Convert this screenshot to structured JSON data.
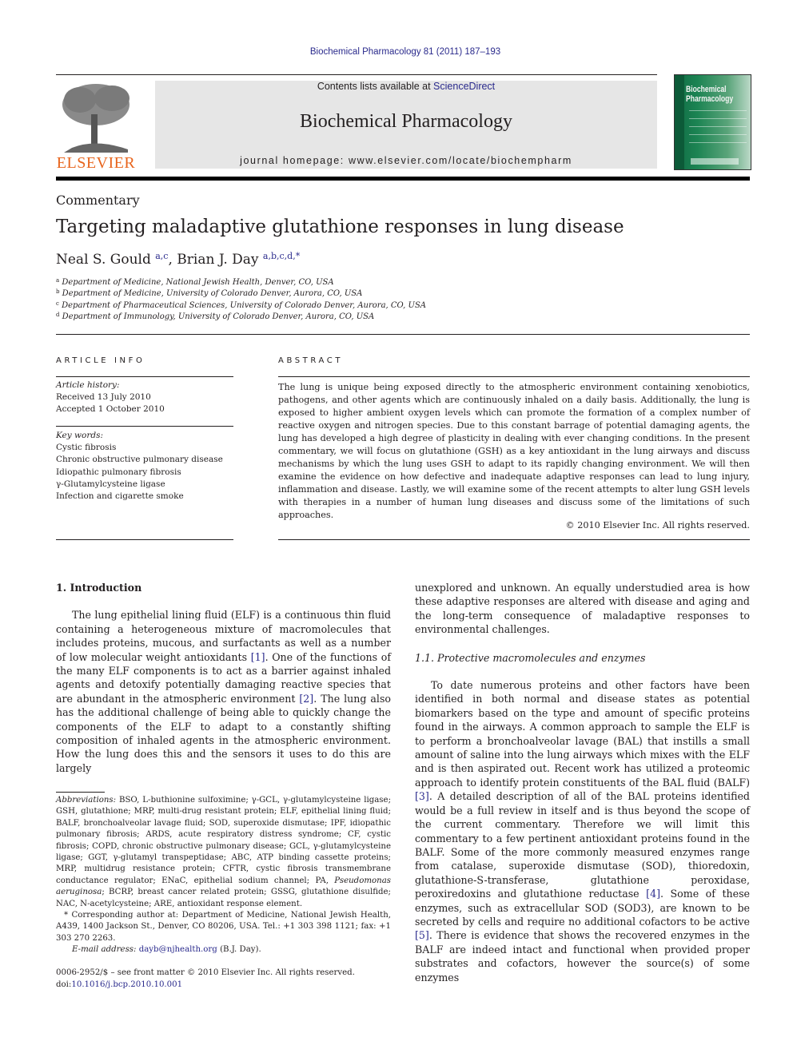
{
  "running_head": "Biochemical Pharmacology 81 (2011) 187–193",
  "masthead": {
    "publisher_logo_text": "ELSEVIER",
    "contents_prefix": "Contents lists available at ",
    "contents_link": "ScienceDirect",
    "journal_name": "Biochemical Pharmacology",
    "homepage": "journal homepage: www.elsevier.com/locate/biochempharm",
    "cover_title_line1": "Biochemical",
    "cover_title_line2": "Pharmacology"
  },
  "article": {
    "type": "Commentary",
    "title": "Targeting maladaptive glutathione responses in lung disease",
    "authors": [
      {
        "name": "Neal S. Gould",
        "affils": "a,c",
        "sep": ", "
      },
      {
        "name": "Brian J. Day",
        "affils": "a,b,c,d,*",
        "sep": ""
      }
    ],
    "affiliations": [
      {
        "mark": "a",
        "text": "Department of Medicine, National Jewish Health, Denver, CO, USA"
      },
      {
        "mark": "b",
        "text": "Department of Medicine, University of Colorado Denver, Aurora, CO, USA"
      },
      {
        "mark": "c",
        "text": "Department of Pharmaceutical Sciences, University of Colorado Denver, Aurora, CO, USA"
      },
      {
        "mark": "d",
        "text": "Department of Immunology, University of Colorado Denver, Aurora, CO, USA"
      }
    ]
  },
  "article_info": {
    "heading": "ARTICLE INFO",
    "history_label": "Article history:",
    "received": "Received 13 July 2010",
    "accepted": "Accepted 1 October 2010",
    "keywords_label": "Key words:",
    "keywords": [
      "Cystic fibrosis",
      "Chronic obstructive pulmonary disease",
      "Idiopathic pulmonary fibrosis",
      "γ-Glutamylcysteine ligase",
      "Infection and cigarette smoke"
    ]
  },
  "abstract": {
    "heading": "ABSTRACT",
    "text": "The lung is unique being exposed directly to the atmospheric environment containing xenobiotics, pathogens, and other agents which are continuously inhaled on a daily basis. Additionally, the lung is exposed to higher ambient oxygen levels which can promote the formation of a complex number of reactive oxygen and nitrogen species. Due to this constant barrage of potential damaging agents, the lung has developed a high degree of plasticity in dealing with ever changing conditions. In the present commentary, we will focus on glutathione (GSH) as a key antioxidant in the lung airways and discuss mechanisms by which the lung uses GSH to adapt to its rapidly changing environment. We will then examine the evidence on how defective and inadequate adaptive responses can lead to lung injury, inflammation and disease. Lastly, we will examine some of the recent attempts to alter lung GSH levels with therapies in a number of human lung diseases and discuss some of the limitations of such approaches.",
    "copyright": "© 2010 Elsevier Inc. All rights reserved."
  },
  "body": {
    "section1_heading": "1.  Introduction",
    "intro_p1_a": "The lung epithelial lining fluid (ELF) is a continuous thin fluid containing a heterogeneous mixture of macromolecules that includes proteins, mucous, and surfactants as well as a number of low molecular weight antioxidants ",
    "ref1": "[1]",
    "intro_p1_b": ". One of the functions of the many ELF components is to act as a barrier against inhaled agents and detoxify potentially damaging reactive species that are abundant in the atmospheric environment ",
    "ref2": "[2]",
    "intro_p1_c": ". The lung also has the additional challenge of being able to quickly change the components of the ELF to adapt to a constantly shifting composition of inhaled agents in the atmospheric environment. How the lung does this and the sensors it uses to do this are largely",
    "intro_p1_cont": "unexplored and unknown. An equally understudied area is how these adaptive responses are altered with disease and aging and the long-term consequence of maladaptive responses to environmental challenges.",
    "subsection_heading": "1.1.  Protective macromolecules and enzymes",
    "p2_a": "To date numerous proteins and other factors have been identified in both normal and disease states as potential biomarkers based on the type and amount of specific proteins found in the airways. A common approach to sample the ELF is to perform a bronchoalveolar lavage (BAL) that instills a small amount of saline into the lung airways which mixes with the ELF and is then aspirated out. Recent work has utilized a proteomic approach to identify protein constituents of the BAL fluid (BALF) ",
    "ref3": "[3]",
    "p2_b": ". A detailed description of all of the BAL proteins identified would be a full review in itself and is thus beyond the scope of the current commentary. Therefore we will limit this commentary to a few pertinent antioxidant proteins found in the BALF. Some of the more commonly measured enzymes range from catalase, superoxide dismutase (SOD), thioredoxin, glutathione-S-transferase, glutathione peroxidase, peroxiredoxins and glutathione reductase ",
    "ref4": "[4]",
    "p2_c": ". Some of these enzymes, such as extracellular SOD (SOD3), are known to be secreted by cells and require no additional cofactors to be active ",
    "ref5": "[5]",
    "p2_d": ". There is evidence that shows the recovered enzymes in the BALF are indeed intact and functional when provided proper substrates and cofactors, however the source(s) of some enzymes"
  },
  "footnotes": {
    "abbrev_label": "Abbreviations:",
    "abbrev_a": " BSO, L-buthionine sulfoximine; γ-GCL, γ-glutamylcysteine ligase; GSH, glutathione; MRP, multi-drug resistant protein; ELF, epithelial lining fluid; BALF, bronchoalveolar lavage fluid; SOD, superoxide dismutase; IPF, idiopathic pulmonary fibrosis; ARDS, acute respiratory distress syndrome; CF, cystic fibrosis; COPD, chronic obstructive pulmonary disease; GCL, γ-glutamylcysteine ligase; GGT, γ-glutamyl transpeptidase; ABC, ATP binding cassette proteins; MRP, multidrug resistance protein; CFTR, cystic fibrosis transmembrane conductance regulator; ENaC, epithelial sodium channel; PA, ",
    "abbrev_italic": "Pseudomonas aeruginosa",
    "abbrev_b": "; BCRP, breast cancer related protein; GSSG, glutathione disulfide; NAC, N-acetylcysteine; ARE, antioxidant response element.",
    "corresponding": "* Corresponding author at: Department of Medicine, National Jewish Health, A439, 1400 Jackson St., Denver, CO 80206, USA. Tel.: +1 303 398 1121; fax: +1 303 270 2263.",
    "email_label": "E-mail address: ",
    "email": "dayb@njhealth.org",
    "email_suffix": " (B.J. Day)."
  },
  "bottom": {
    "issn_line": "0006-2952/$ – see front matter © 2010 Elsevier Inc. All rights reserved.",
    "doi_prefix": "doi:",
    "doi": "10.1016/j.bcp.2010.10.001"
  }
}
